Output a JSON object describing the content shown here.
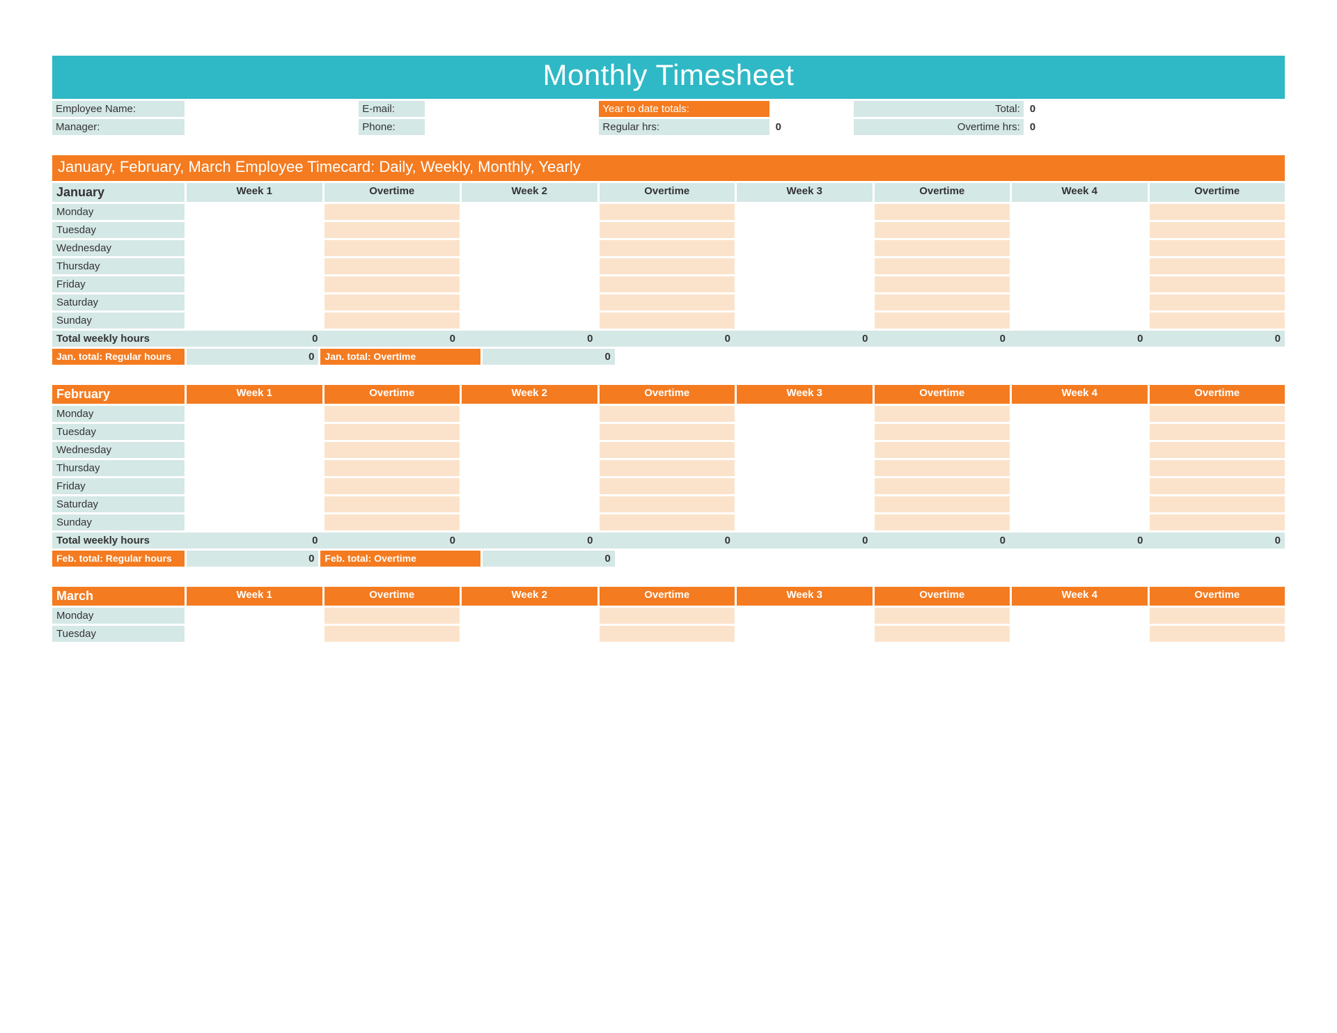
{
  "title": "Monthly Timesheet",
  "header": {
    "employee_name_label": "Employee Name:",
    "email_label": "E-mail:",
    "ytd_label": "Year to date totals:",
    "total_label": "Total:",
    "total_value": "0",
    "manager_label": "Manager:",
    "phone_label": "Phone:",
    "regular_hrs_label": "Regular hrs:",
    "regular_hrs_value": "0",
    "overtime_hrs_label": "Overtime hrs:",
    "overtime_hrs_value": "0"
  },
  "section_title": "January, February, March Employee Timecard: Daily, Weekly, Monthly, Yearly",
  "col_headers": [
    "Week 1",
    "Overtime",
    "Week 2",
    "Overtime",
    "Week 3",
    "Overtime",
    "Week 4",
    "Overtime"
  ],
  "days": [
    "Monday",
    "Tuesday",
    "Wednesday",
    "Thursday",
    "Friday",
    "Saturday",
    "Sunday"
  ],
  "months": {
    "jan": {
      "name": "January",
      "total_row_label": "Total weekly hours",
      "totals": [
        "0",
        "0",
        "0",
        "0",
        "0",
        "0",
        "0",
        "0"
      ],
      "reg_label": "Jan. total: Regular hours",
      "reg_value": "0",
      "ot_label": "Jan. total: Overtime",
      "ot_value": "0"
    },
    "feb": {
      "name": "February",
      "total_row_label": "Total weekly hours",
      "totals": [
        "0",
        "0",
        "0",
        "0",
        "0",
        "0",
        "0",
        "0"
      ],
      "reg_label": "Feb. total: Regular hours",
      "reg_value": "0",
      "ot_label": "Feb. total: Overtime",
      "ot_value": "0"
    },
    "mar": {
      "name": "March",
      "days_shown": [
        "Monday",
        "Tuesday"
      ]
    }
  }
}
